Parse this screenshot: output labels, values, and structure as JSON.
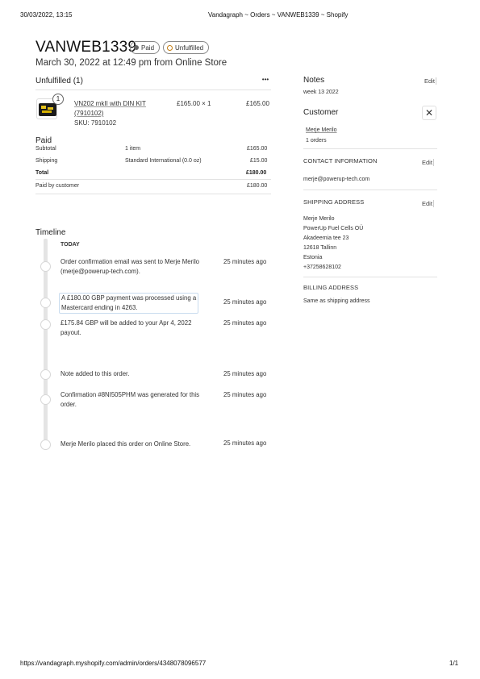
{
  "print_header": {
    "datetime": "30/03/2022, 13:15",
    "page_title": "Vandagraph ~ Orders ~ VANWEB1339 ~ Shopify"
  },
  "order": {
    "number": "VANWEB1339",
    "badges": {
      "paid": "Paid",
      "unfulfilled": "Unfulfilled"
    },
    "subtitle": "March 30, 2022 at 12:49 pm from Online Store"
  },
  "unfulfilled": {
    "title": "Unfulfilled (1)",
    "more": "•••",
    "item": {
      "qty_badge": "1",
      "name_line1": "VN202 mkII with DIN KIT",
      "name_line2": "(7910102)",
      "sku": "SKU: 7910102",
      "unit_price": "£165.00 × 1",
      "total": "£165.00"
    }
  },
  "paid": {
    "title": "Paid",
    "rows": [
      {
        "label": "Subtotal",
        "detail": "1 item",
        "amount": "£165.00"
      },
      {
        "label": "Shipping",
        "detail": "Standard International (0.0 oz)",
        "amount": "£15.00"
      },
      {
        "label": "Total",
        "detail": "",
        "amount": "£180.00"
      },
      {
        "label": "Paid by customer",
        "detail": "",
        "amount": "£180.00"
      }
    ]
  },
  "timeline": {
    "title": "Timeline",
    "today": "TODAY",
    "events": [
      {
        "line1": "Order confirmation email was sent to Merje Merilo",
        "line2": "(merje@powerup-tech.com).",
        "time": "25 minutes ago"
      },
      {
        "line1": "A £180.00 GBP payment was processed using a",
        "line2": "Mastercard ending in 4263.",
        "time": "25 minutes ago"
      },
      {
        "line1": "£175.84 GBP will be added to your Apr 4, 2022",
        "line2": "payout.",
        "time": "25 minutes ago"
      },
      {
        "line1": "Note added to this order.",
        "line2": "",
        "time": "25 minutes ago"
      },
      {
        "line1": "Confirmation #8NI505PHM was generated for this",
        "line2": "order.",
        "time": "25 minutes ago"
      },
      {
        "line1": "Merje Merilo placed this order on Online Store.",
        "line2": "",
        "time": "25 minutes ago"
      }
    ]
  },
  "notes": {
    "title": "Notes",
    "edit": "Edit",
    "text": "week 13 2022"
  },
  "customer": {
    "title": "Customer",
    "close": "✕",
    "name": "Merje Merilo",
    "orders": "1 orders",
    "contact": {
      "title": "CONTACT INFORMATION",
      "edit": "Edit",
      "email": "merje@powerup-tech.com"
    },
    "shipping": {
      "title": "SHIPPING ADDRESS",
      "edit": "Edit",
      "lines": [
        "Merje Merilo",
        "PowerUp Fuel Cells OÜ",
        "Akadeemia tee 23",
        "12618 Tallinn",
        "Estonia",
        "+37258628102"
      ]
    },
    "billing": {
      "title": "BILLING ADDRESS",
      "text": "Same as shipping address"
    }
  },
  "print_footer": {
    "url": "https://vandagraph.myshopify.com/admin/orders/4348078096577",
    "page": "1/1"
  },
  "colors": {
    "paid_dot": "#666666",
    "unfulfilled_dot": "#c47d12"
  }
}
